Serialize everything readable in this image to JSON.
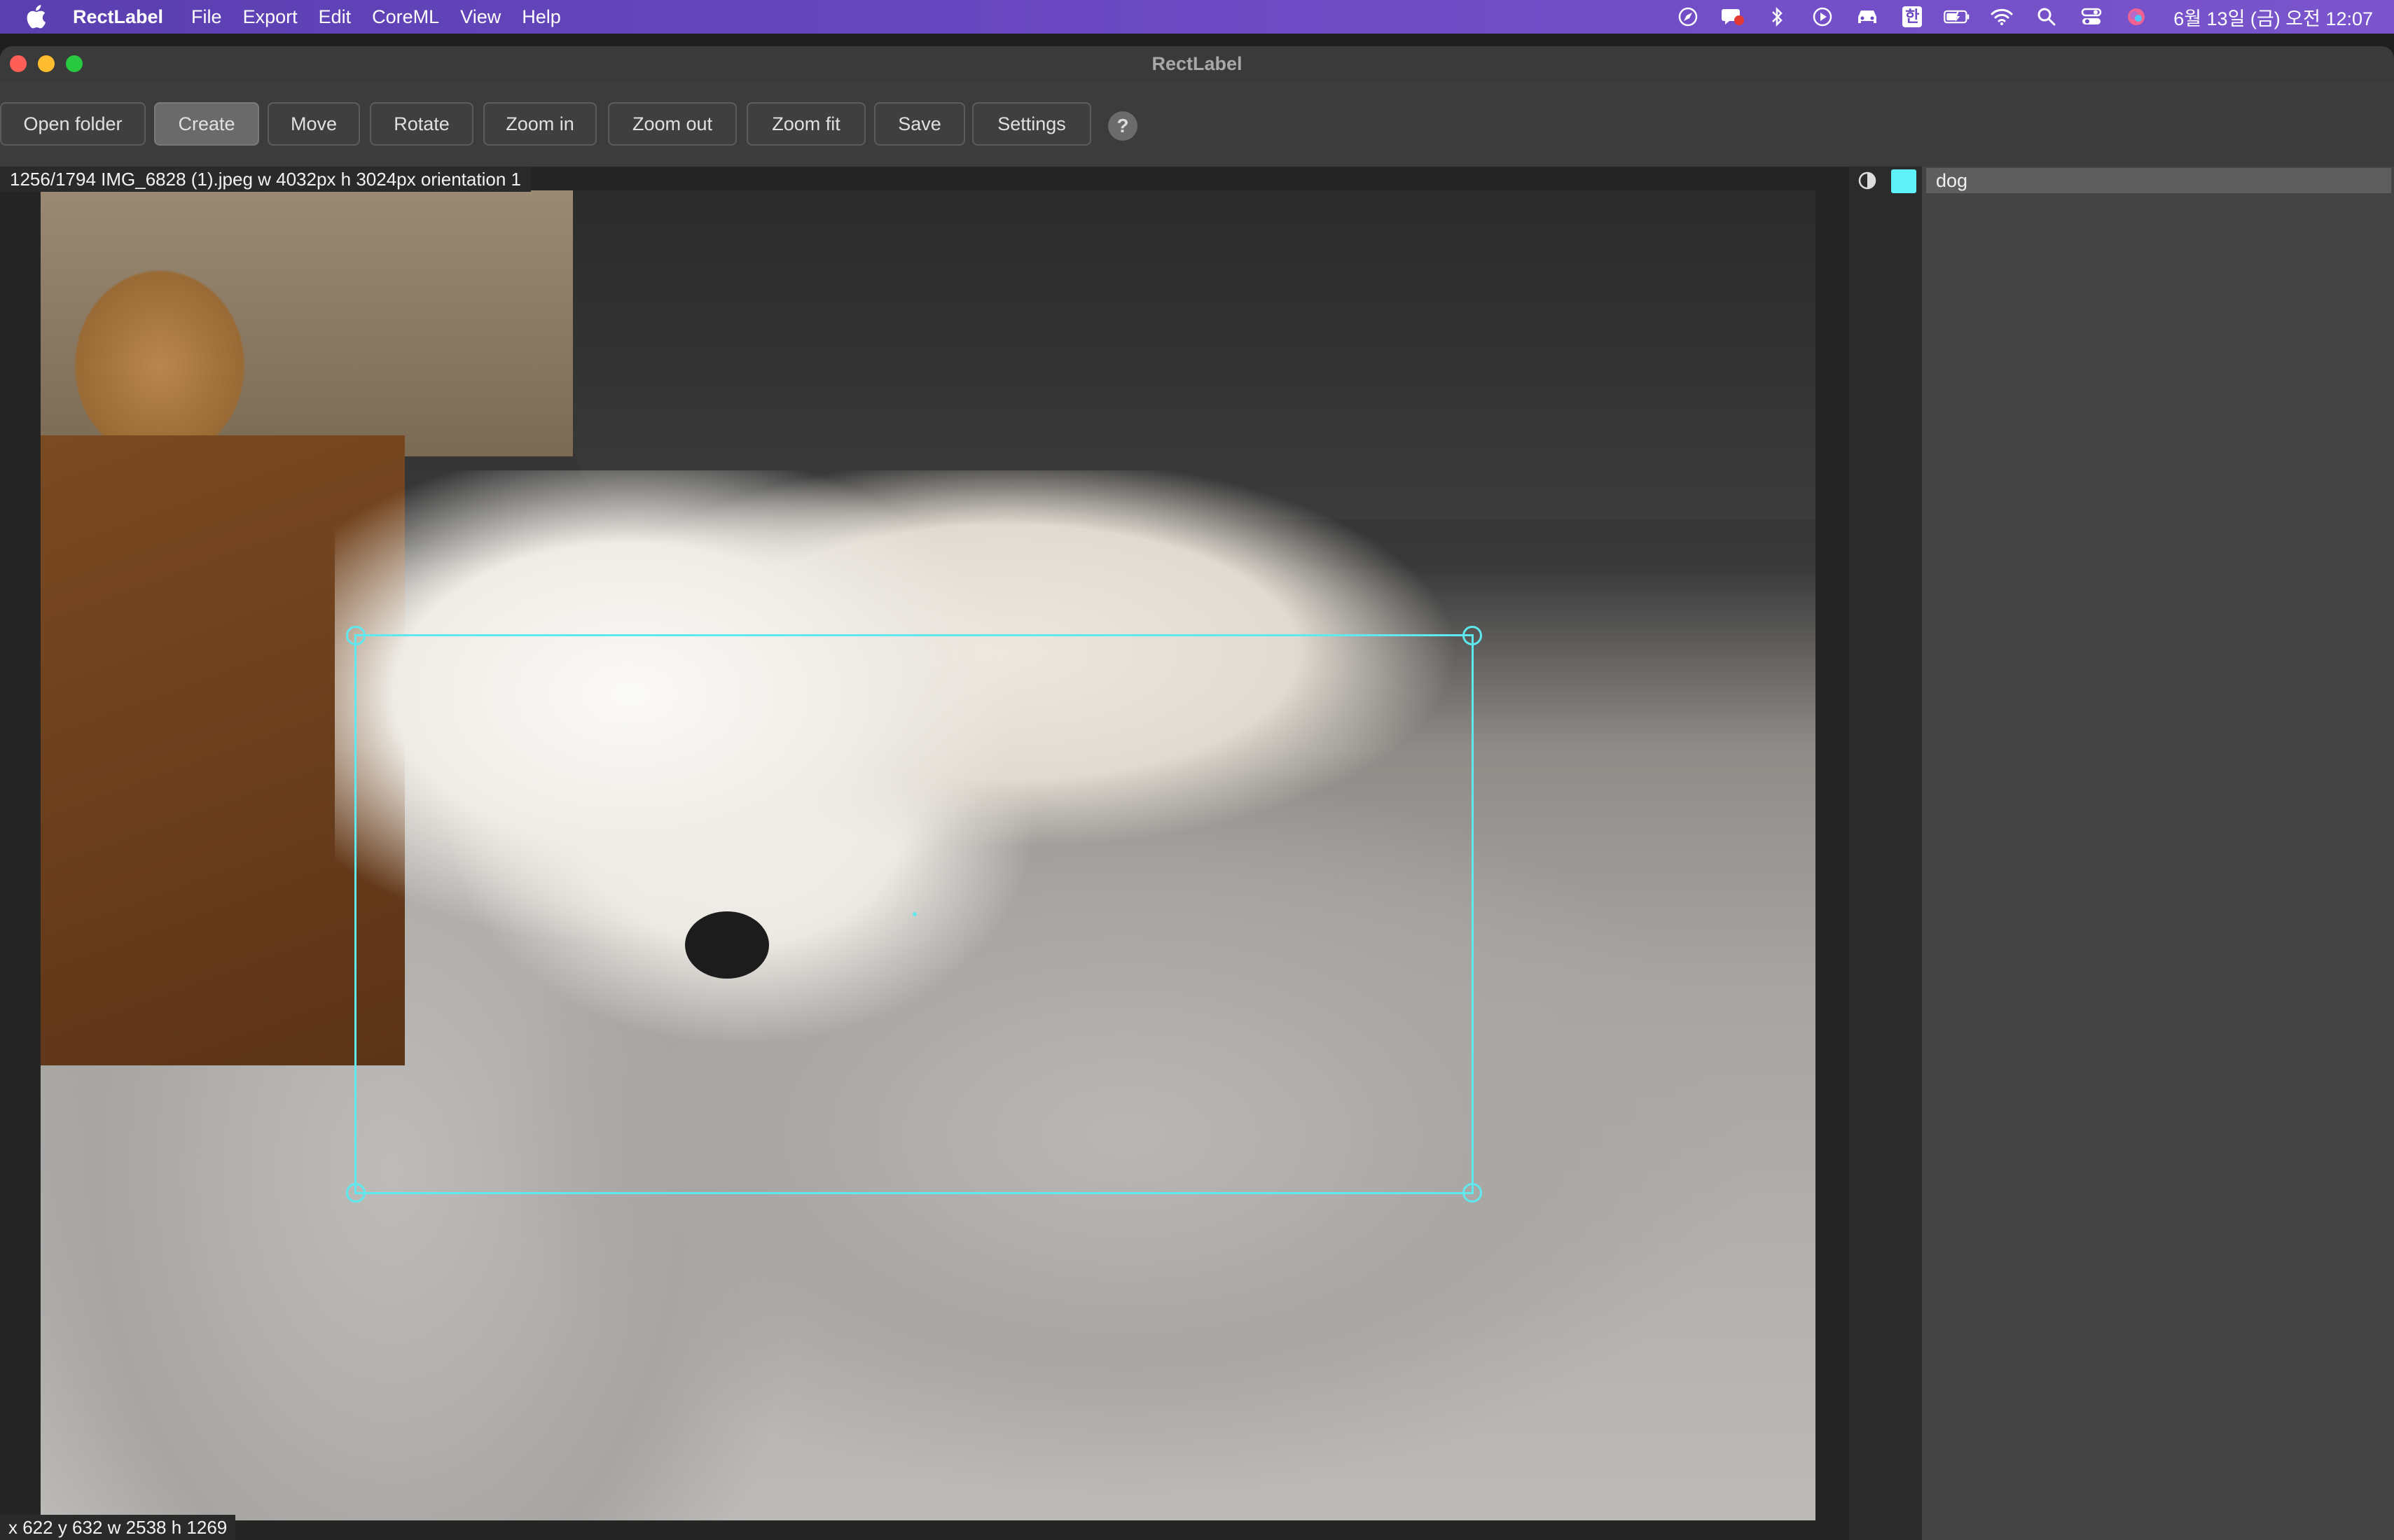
{
  "menubar": {
    "apple_icon": "apple-logo-icon",
    "app_name": "RectLabel",
    "items": [
      "File",
      "Export",
      "Edit",
      "CoreML",
      "View",
      "Help"
    ],
    "status_icons": [
      "safari-compass-icon",
      "chat-bubble-icon",
      "bluetooth-icon",
      "play-circle-icon",
      "car-icon",
      "hangul-input-icon",
      "battery-icon",
      "wifi-icon",
      "search-icon",
      "control-center-icon",
      "siri-icon"
    ],
    "input_source_label": "한",
    "clock": "6월 13일 (금) 오전 12:07"
  },
  "window": {
    "title": "RectLabel"
  },
  "toolbar": {
    "buttons": [
      {
        "label": "Open folder"
      },
      {
        "label": "Create"
      },
      {
        "label": "Move"
      },
      {
        "label": "Rotate"
      },
      {
        "label": "Zoom in"
      },
      {
        "label": "Zoom out"
      },
      {
        "label": "Zoom fit"
      },
      {
        "label": "Save"
      },
      {
        "label": "Settings"
      }
    ],
    "active_button": "Create",
    "help_label": "?"
  },
  "image_info": "1256/1794 IMG_6828 (1).jpeg w 4032px h 3024px orientation 1",
  "selection_info": "x 622 y 632 w 2538 h 1269",
  "annotation": {
    "label": "dog",
    "color": "#5ff2f8"
  },
  "labels_panel": {
    "items": [
      {
        "name": "dog",
        "color": "#5ff2f8"
      }
    ]
  }
}
